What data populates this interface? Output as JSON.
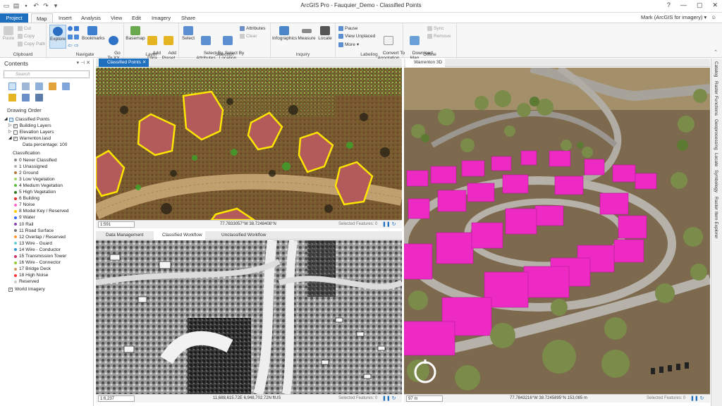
{
  "titlebar": {
    "title": "ArcGIS Pro - Fauquier_Demo - Classified Points",
    "help": "?",
    "minimize": "—",
    "restore": "▢",
    "close": "✕"
  },
  "tabs": {
    "project": "Project",
    "map": "Map",
    "insert": "Insert",
    "analysis": "Analysis",
    "view": "View",
    "edit": "Edit",
    "imagery": "Imagery",
    "share": "Share"
  },
  "user": {
    "name": "Mark (ArcGIS for imagery) ▾",
    "smiley": "☺"
  },
  "ribbon": {
    "clipboard": {
      "label": "Clipboard",
      "paste": "Paste",
      "cut": "Cut",
      "copy": "Copy",
      "copy_path": "Copy Path"
    },
    "navigate": {
      "label": "Navigate",
      "explore": "Explore",
      "bookmarks": "Bookmarks",
      "go_to_xy": "Go\nTo XY"
    },
    "layer": {
      "label": "Layer",
      "basemap": "Basemap",
      "add_data": "Add\nData",
      "add_preset": "Add\nPreset"
    },
    "selection": {
      "label": "Selection",
      "select": "Select",
      "select_by_attributes": "Select By\nAttributes",
      "select_by_location": "Select By\nLocation",
      "attributes": "Attributes",
      "clear": "Clear"
    },
    "inquiry": {
      "label": "Inquiry",
      "infographics": "Infographics",
      "measure": "Measure",
      "locate": "Locate"
    },
    "labeling": {
      "label": "Labeling",
      "pause": "Pause",
      "view_unplaced": "View Unplaced",
      "more": "More",
      "convert": "Convert To\nAnnotation"
    },
    "offline": {
      "label": "Offline",
      "download_map": "Download\nMap",
      "sync": "Sync",
      "remove": "Remove"
    }
  },
  "contents": {
    "title": "Contents",
    "search_placeholder": "Search",
    "drawing_order": "Drawing Order",
    "map_name": "Classified Points",
    "layers": [
      "Building Layers",
      "Elevation Layers",
      "Warrenton.lasd"
    ],
    "data_percentage": "Data percentage: 100",
    "classification_label": "Classification",
    "classes": [
      {
        "label": "0  Never Classified",
        "color": "#8a8a8a"
      },
      {
        "label": "1  Unassigned",
        "color": "#b0b0b0"
      },
      {
        "label": "2  Ground",
        "color": "#b07a3c"
      },
      {
        "label": "3  Low Vegetation",
        "color": "#9ed46b"
      },
      {
        "label": "4  Medium Vegetation",
        "color": "#5ab83a"
      },
      {
        "label": "5  High Vegetation",
        "color": "#2e7d1e"
      },
      {
        "label": "6  Building",
        "color": "#e03030"
      },
      {
        "label": "7  Noise",
        "color": "#ff66cc"
      },
      {
        "label": "8  Model Key / Reserved",
        "color": "#ffcc00"
      },
      {
        "label": "9  Water",
        "color": "#3366ff"
      },
      {
        "label": "10  Rail",
        "color": "#8844aa"
      },
      {
        "label": "11  Road Surface",
        "color": "#777777"
      },
      {
        "label": "12  Overlap / Reserved",
        "color": "#ff9933"
      },
      {
        "label": "13  Wire - Guard",
        "color": "#66cccc"
      },
      {
        "label": "14  Wire - Conductor",
        "color": "#3399cc"
      },
      {
        "label": "15  Transmission Tower",
        "color": "#cc3366"
      },
      {
        "label": "16  Wire - Connector",
        "color": "#99cc33"
      },
      {
        "label": "17  Bridge Deck",
        "color": "#cc9966"
      },
      {
        "label": "18  High Noise",
        "color": "#ff3333"
      },
      {
        "label": "Reserved",
        "color": "#cccccc"
      }
    ],
    "world_imagery": "World Imagery"
  },
  "views": {
    "classified_tab": "Classified Points",
    "classified_scale": "1:591",
    "classified_coords": "77.7833057°W 38.7248408°N",
    "classified_selected": "Selected Features: 0",
    "data_mgmt_tab": "Data Management",
    "classified_workflow_tab": "Classified Workflow",
    "unclassified_workflow_tab": "Unclassified Workflow",
    "dm_scale": "1:6,237",
    "dm_coords": "11,688,615.72E 6,948,702.72N ftUS",
    "dm_selected": "Selected Features: 0",
    "warrenton_tab": "Warrenton 3D",
    "w3d_scale": "97 m",
    "w3d_coords": "77.7843216°W 38.7245895°N   153,085 m",
    "w3d_selected": "Selected Features: 0"
  },
  "rightdock": [
    "Catalog",
    "Raster Functions",
    "Geoprocessing",
    "Locate",
    "Symbology",
    "Raster Item Explorer"
  ]
}
